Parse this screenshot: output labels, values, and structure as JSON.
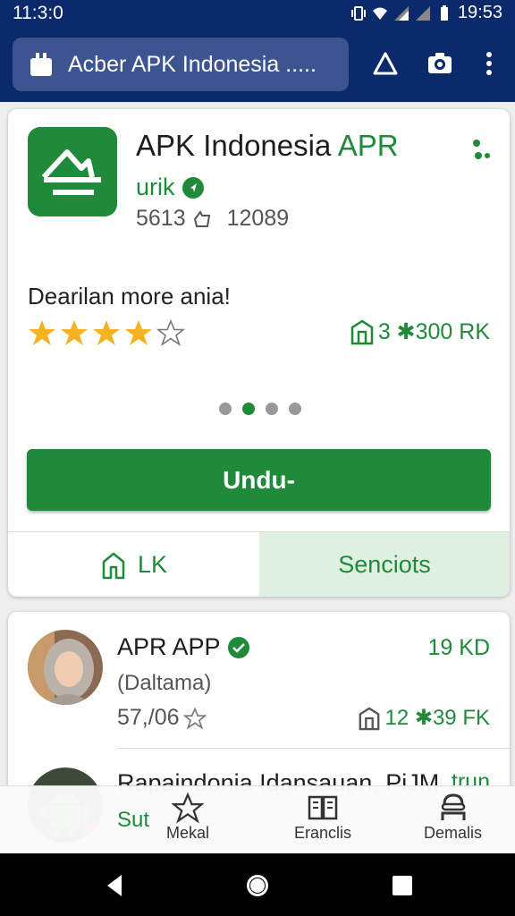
{
  "status_bar": {
    "time": "11:3:0",
    "clock_right": "19:53",
    "icons": [
      "vibrate-icon",
      "wifi-icon",
      "signal-icon",
      "signal-icon",
      "battery-icon"
    ]
  },
  "browser": {
    "url_text": "Acber APK Indonesia .....",
    "icons": [
      "page-icon",
      "warning-icon",
      "camera-icon",
      "more-vert-icon"
    ]
  },
  "app": {
    "title_main": "APK Indonesia",
    "title_accent": "APR",
    "developer": "urik",
    "downloads": "5613",
    "reviews": "12089",
    "description": "Dearilan more ania!",
    "rating": 4,
    "rating_max": 5,
    "size": "3 ✱300 RK",
    "screenshot_pages": 4,
    "screenshot_current": 2,
    "download_label": "Undu-",
    "share_label": "LK",
    "screenshots_label": "Senciots"
  },
  "list": [
    {
      "title": "APR APP",
      "subtitle": "(Daltama)",
      "price": "19 KD",
      "rating_text": "57,/06",
      "size": "12 ✱39 FK"
    },
    {
      "title": "Rapaindonia Idansauan, PiJM",
      "price_partial": "trun"
    }
  ],
  "tab_bar": {
    "partial_label": "Sut",
    "tabs": [
      {
        "label": "Mekal",
        "icon": "star-icon"
      },
      {
        "label": "Eranclis",
        "icon": "book-icon"
      },
      {
        "label": "Demalis",
        "icon": "person-icon"
      }
    ]
  },
  "colors": {
    "brand_green": "#1f8a3a",
    "header_navy": "#0b2a6b",
    "star_gold": "#f5b324"
  }
}
